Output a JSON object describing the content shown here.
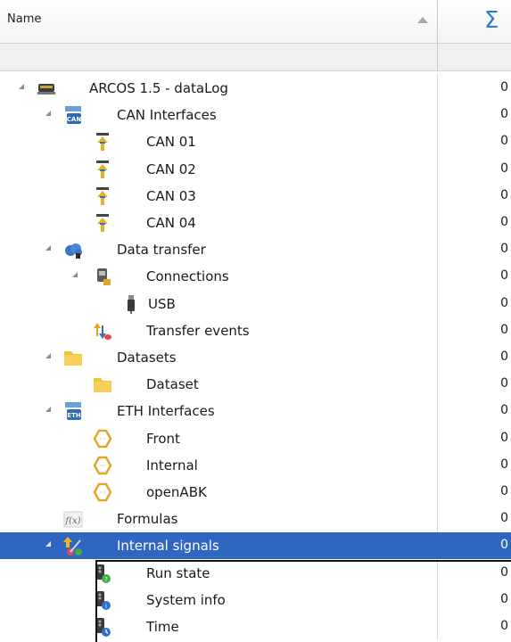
{
  "header": {
    "name_label": "Name",
    "sort_icon": "sort-ascending-icon",
    "sum_symbol": "Σ"
  },
  "tree": {
    "rows": [
      {
        "label": "ARCOS 1.5 - dataLog",
        "count": "0",
        "icon": "datalogger-device-icon",
        "level": 0,
        "expandable": true
      },
      {
        "label": "CAN Interfaces",
        "count": "0",
        "icon": "can-interfaces-icon",
        "level": 1,
        "expandable": true
      },
      {
        "label": "CAN 01",
        "count": "0",
        "icon": "can-port-icon",
        "level": 2,
        "expandable": false
      },
      {
        "label": "CAN 02",
        "count": "0",
        "icon": "can-port-icon",
        "level": 2,
        "expandable": false
      },
      {
        "label": "CAN 03",
        "count": "0",
        "icon": "can-port-icon",
        "level": 2,
        "expandable": false
      },
      {
        "label": "CAN 04",
        "count": "0",
        "icon": "can-port-icon",
        "level": 2,
        "expandable": false
      },
      {
        "label": "Data transfer",
        "count": "0",
        "icon": "cloud-transfer-icon",
        "level": 1,
        "expandable": true
      },
      {
        "label": "Connections",
        "count": "0",
        "icon": "connections-icon",
        "level": 2,
        "expandable": true
      },
      {
        "label": "USB",
        "count": "0",
        "icon": "usb-icon",
        "level": 3,
        "expandable": false
      },
      {
        "label": "Transfer events",
        "count": "0",
        "icon": "transfer-events-icon",
        "level": 2,
        "expandable": false
      },
      {
        "label": "Datasets",
        "count": "0",
        "icon": "folder-icon",
        "level": 1,
        "expandable": true
      },
      {
        "label": "Dataset",
        "count": "0",
        "icon": "folder-icon",
        "level": 2,
        "expandable": false
      },
      {
        "label": "ETH Interfaces",
        "count": "0",
        "icon": "eth-interfaces-icon",
        "level": 1,
        "expandable": true
      },
      {
        "label": "Front",
        "count": "0",
        "icon": "eth-port-icon",
        "level": 2,
        "expandable": false
      },
      {
        "label": "Internal",
        "count": "0",
        "icon": "eth-port-icon",
        "level": 2,
        "expandable": false
      },
      {
        "label": "openABK",
        "count": "0",
        "icon": "eth-port-icon",
        "level": 2,
        "expandable": false
      },
      {
        "label": "Formulas",
        "count": "0",
        "icon": "formula-icon",
        "level": 1,
        "expandable": false
      },
      {
        "label": "Internal signals",
        "count": "0",
        "icon": "internal-signals-icon",
        "level": 1,
        "expandable": true,
        "selected": true
      },
      {
        "label": "Run state",
        "count": "0",
        "icon": "signal-run-state-icon",
        "level": 2,
        "expandable": false
      },
      {
        "label": "System info",
        "count": "0",
        "icon": "signal-info-icon",
        "level": 2,
        "expandable": false
      },
      {
        "label": "Time",
        "count": "0",
        "icon": "signal-time-icon",
        "level": 2,
        "expandable": false
      }
    ]
  },
  "colors": {
    "selection": "#2f66c2",
    "sigma": "#2e7bd0"
  }
}
